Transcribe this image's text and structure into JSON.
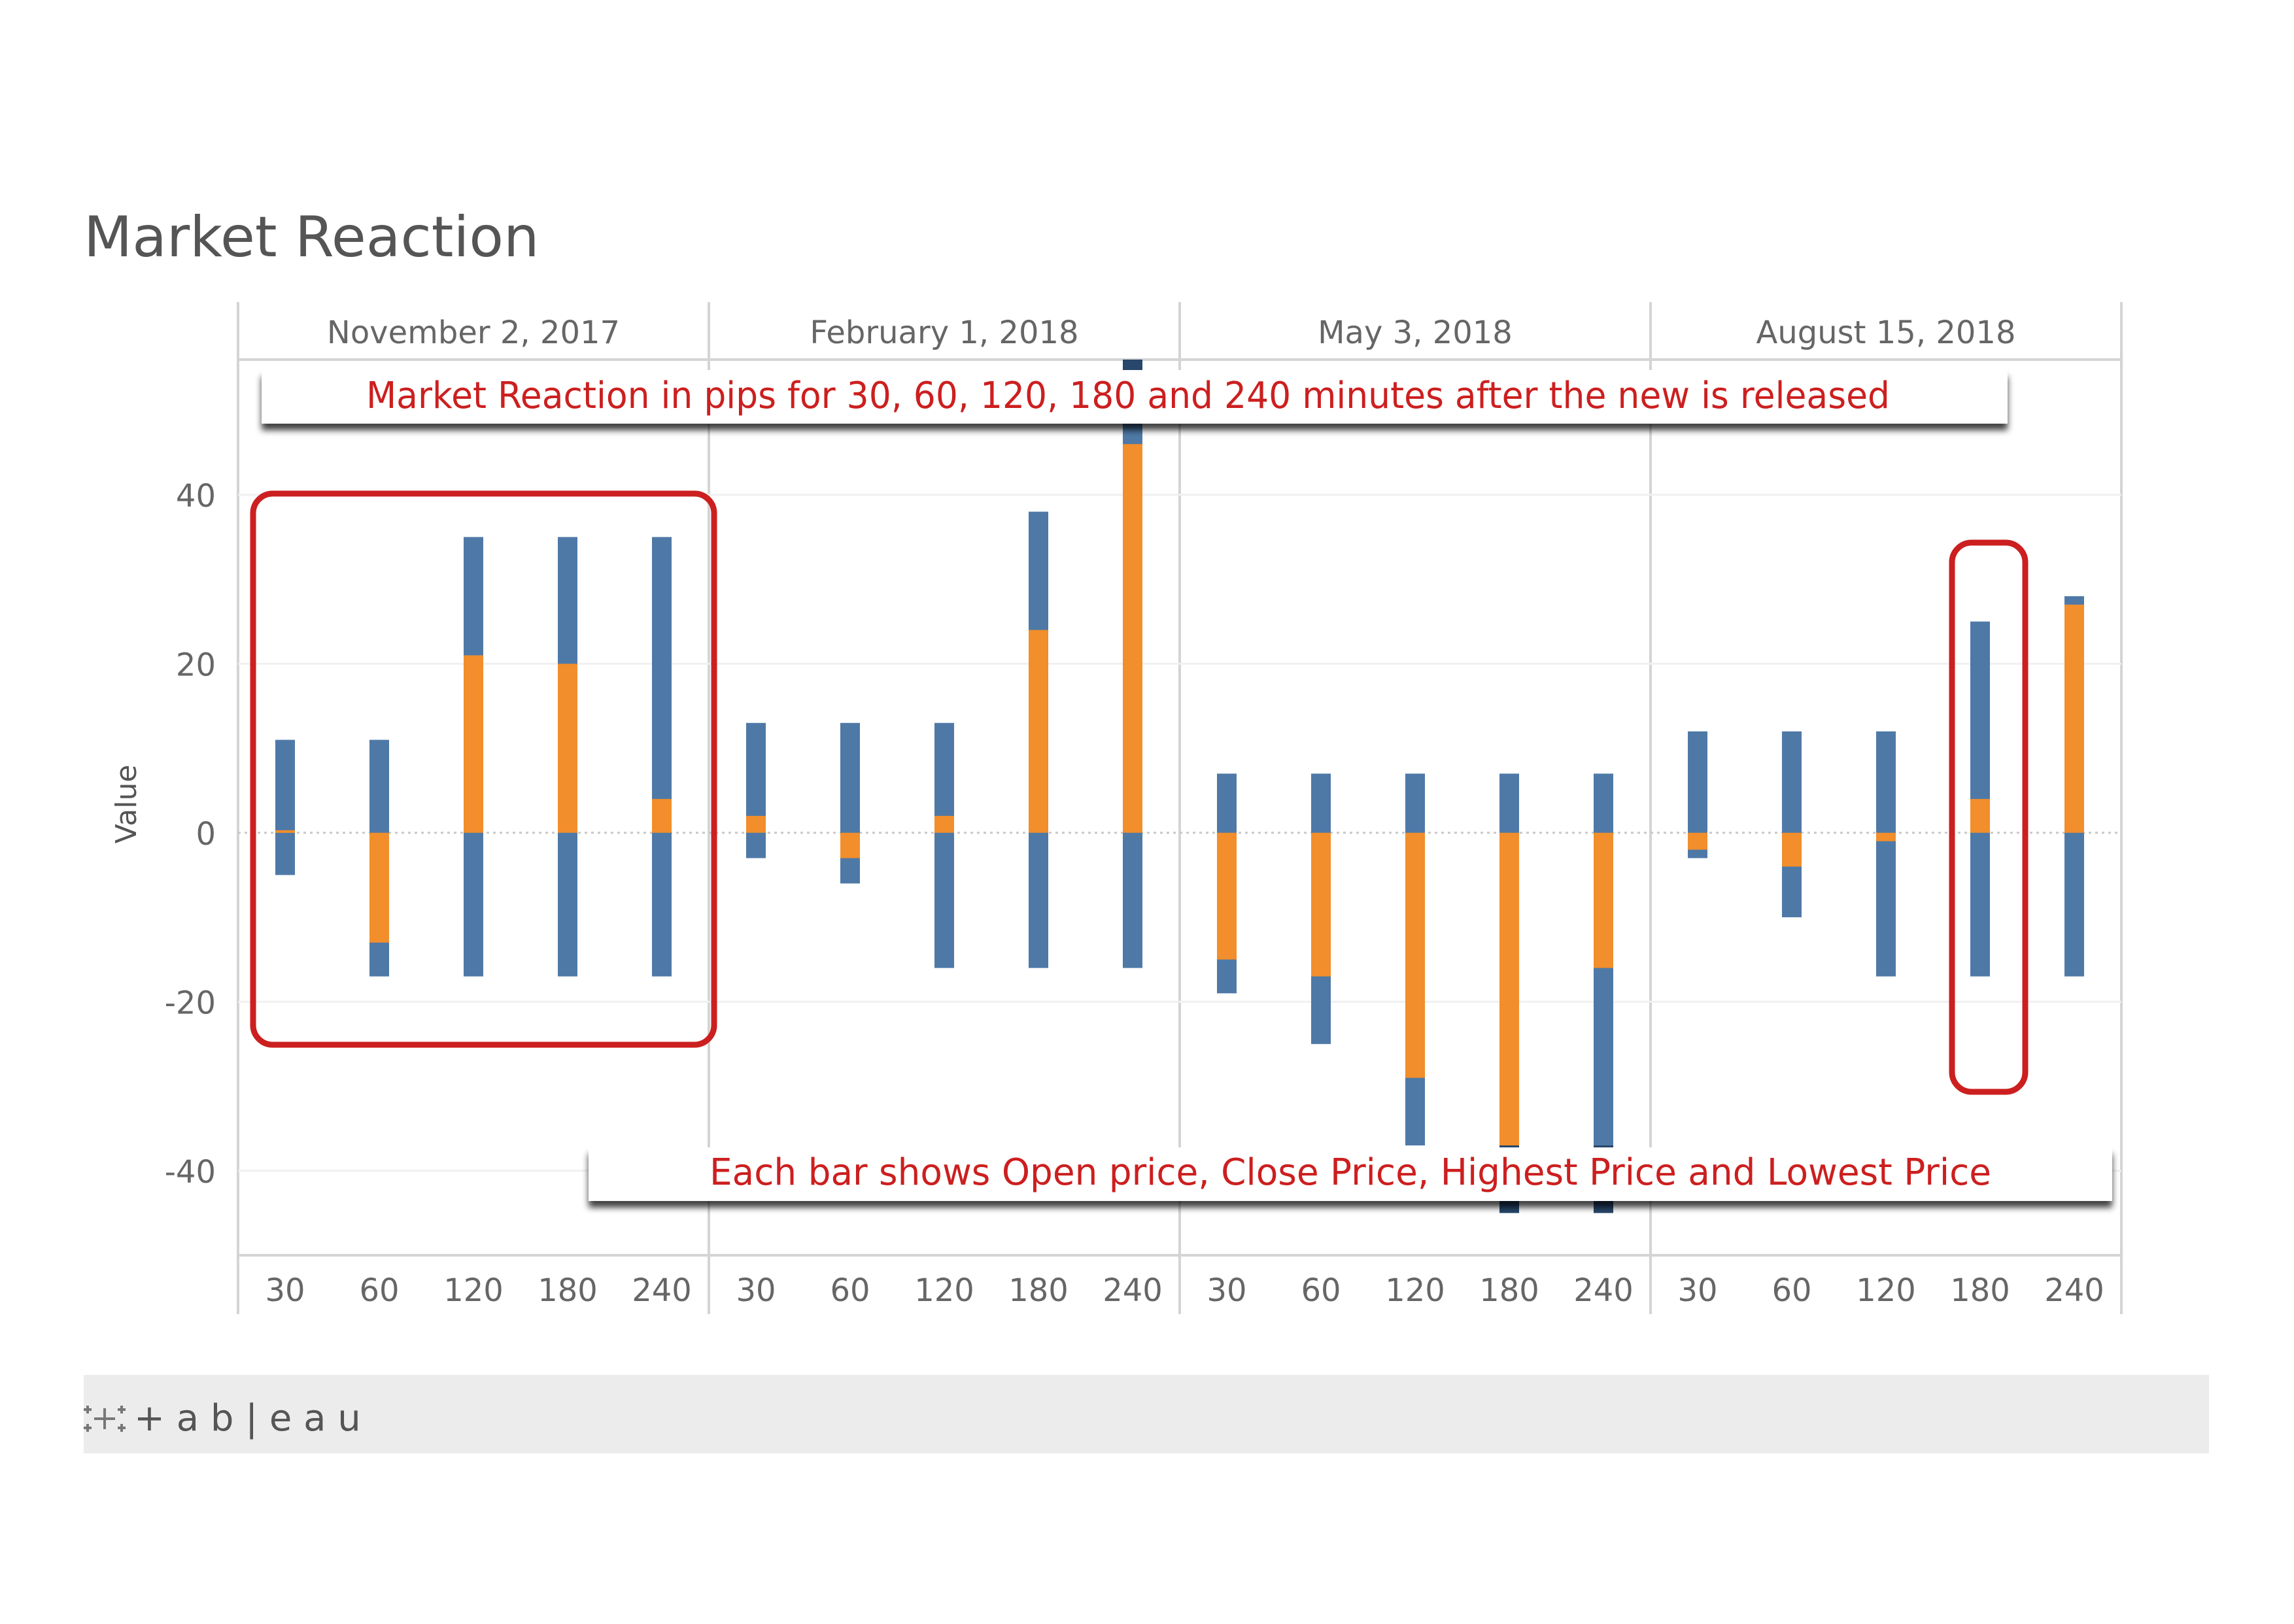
{
  "page_title": "Market Reaction",
  "chart_data": {
    "type": "bar",
    "title": "Market Reaction",
    "subtitle": "Market Reaction in pips for 30, 60, 120, 180 and 240 minutes after the new is released",
    "caption": "Each bar shows Open price, Close Price, Highest Price and Lowest Price",
    "ylabel": "Value",
    "xlabel": "",
    "ylim": [
      -50,
      56
    ],
    "yticks": [
      40,
      20,
      0,
      -20,
      -40
    ],
    "grid": true,
    "legend": "none",
    "colors": {
      "range": "#4e79a7",
      "body": "#f28e2b",
      "overflow": "#27476b",
      "highlight": "#cc1f1f"
    },
    "panels": [
      {
        "date": "November 2, 2017",
        "categories": [
          "30",
          "60",
          "120",
          "180",
          "240"
        ],
        "low": [
          -5,
          -17,
          -17,
          -17,
          -17
        ],
        "high": [
          11,
          11,
          35,
          35,
          35
        ],
        "open": [
          0,
          0,
          0,
          0,
          0
        ],
        "close": [
          0.3,
          -13,
          21,
          20,
          4
        ]
      },
      {
        "date": "February 1, 2018",
        "categories": [
          "30",
          "60",
          "120",
          "180",
          "240"
        ],
        "low": [
          -3,
          -6,
          -16,
          -16,
          -16
        ],
        "high": [
          13,
          13,
          13,
          38,
          56
        ],
        "open": [
          0,
          0,
          0,
          0,
          0
        ],
        "close": [
          2,
          -3,
          2,
          24,
          46
        ]
      },
      {
        "date": "May 3, 2018",
        "categories": [
          "30",
          "60",
          "120",
          "180",
          "240"
        ],
        "low": [
          -19,
          -25,
          -37,
          -45,
          -45
        ],
        "high": [
          7,
          7,
          7,
          7,
          7
        ],
        "open": [
          0,
          0,
          0,
          0,
          0
        ],
        "close": [
          -15,
          -17,
          -29,
          -37,
          -16
        ]
      },
      {
        "date": "August 15, 2018",
        "categories": [
          "30",
          "60",
          "120",
          "180",
          "240"
        ],
        "low": [
          -3,
          -10,
          -17,
          -17,
          -17
        ],
        "high": [
          12,
          12,
          12,
          25,
          28
        ],
        "open": [
          0,
          0,
          0,
          0,
          0
        ],
        "close": [
          -2,
          -4,
          -1,
          4,
          27
        ]
      }
    ]
  },
  "footer": {
    "logo_text": "+ a b | e a u"
  }
}
